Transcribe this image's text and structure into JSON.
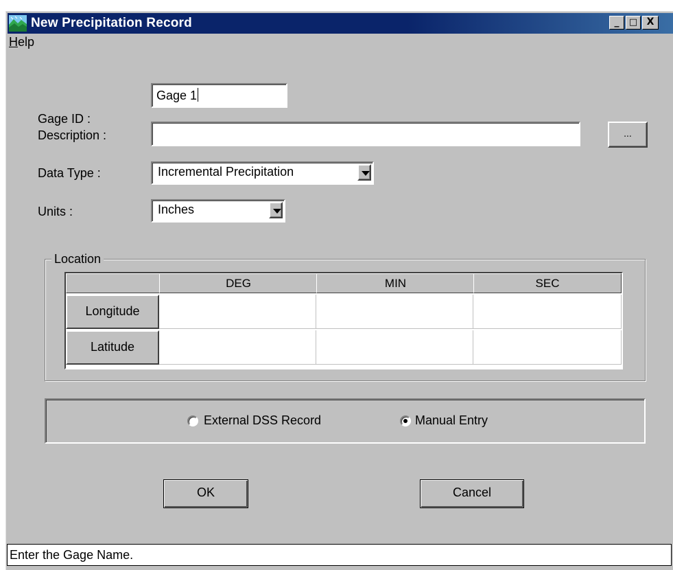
{
  "window": {
    "title": "New Precipitation Record",
    "controls": {
      "minimize": "_",
      "maximize": "□",
      "close": "X"
    },
    "icon": "app-icon"
  },
  "menubar": {
    "items": [
      {
        "label": "Help",
        "mnemonic": "H",
        "rest": "elp"
      }
    ]
  },
  "form": {
    "gage_id_label": "Gage ID :",
    "gage_id_value": "Gage 1",
    "description_label": "Description :",
    "description_value": "",
    "description_button": "...",
    "data_type_label": "Data Type :",
    "data_type_value": "Incremental Precipitation",
    "units_label": "Units :",
    "units_value": "Inches"
  },
  "location": {
    "title": "Location",
    "columns": [
      "DEG",
      "MIN",
      "SEC"
    ],
    "rows": [
      {
        "label": "Longitude",
        "values": [
          "",
          "",
          ""
        ]
      },
      {
        "label": "Latitude",
        "values": [
          "",
          "",
          ""
        ]
      }
    ]
  },
  "source": {
    "options": [
      {
        "label": "External DSS Record",
        "selected": false
      },
      {
        "label": "Manual Entry",
        "selected": true
      }
    ]
  },
  "buttons": {
    "ok": "OK",
    "cancel": "Cancel"
  },
  "status_bar": {
    "text": "Enter the Gage Name."
  },
  "colors": {
    "titlebar": "#0a246a",
    "face": "#c0c0c0",
    "field": "#ffffff"
  }
}
